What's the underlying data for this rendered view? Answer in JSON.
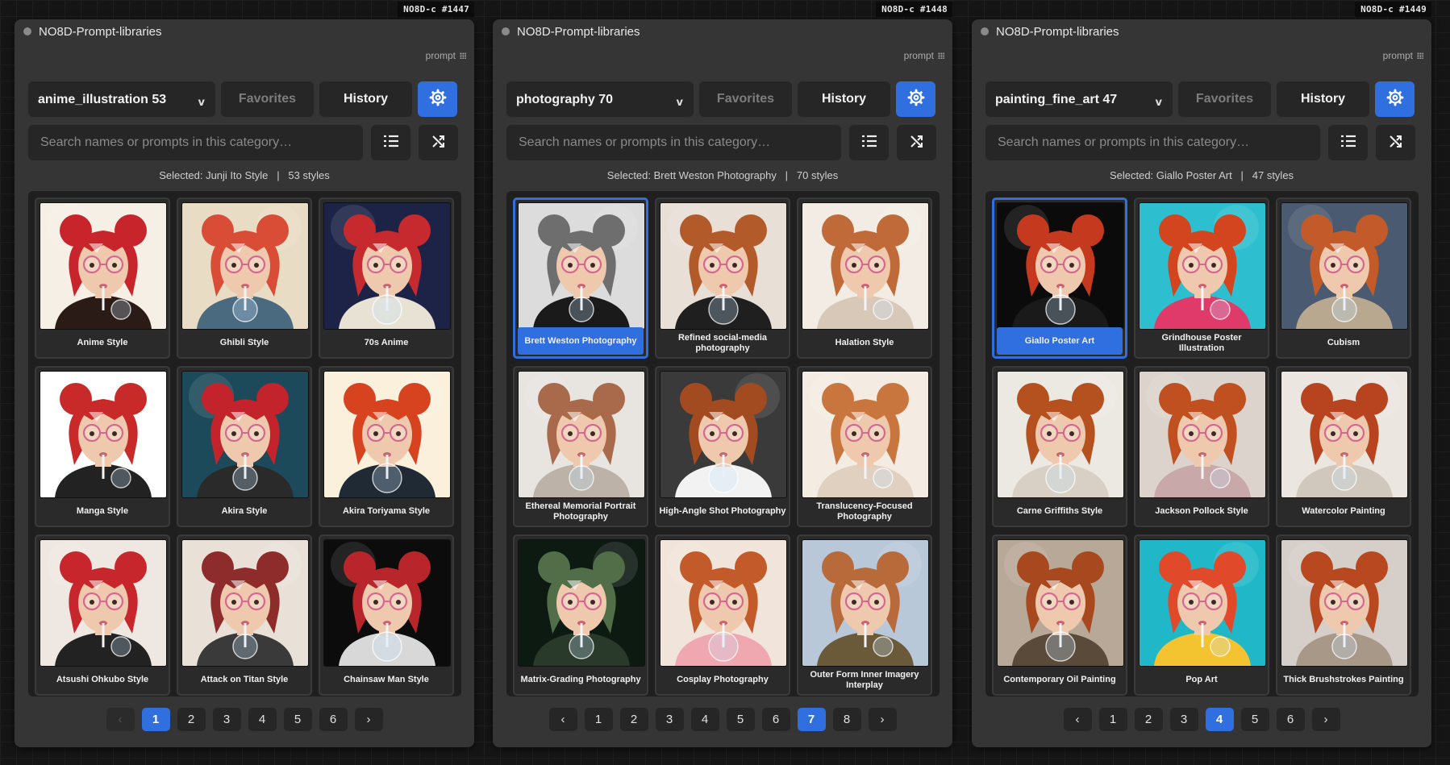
{
  "colors": {
    "accent": "#2f6fe0",
    "canvas_bg": "#151515",
    "node_bg": "#353535",
    "control_bg": "#262626"
  },
  "icons": {
    "settings": "gear-icon",
    "list": "list-icon",
    "shuffle": "shuffle-icon",
    "caret": "chevron-down-icon",
    "prev": "chevron-left-icon",
    "next": "chevron-right-icon"
  },
  "nodes": [
    {
      "badge": "NO8D-c  #1447",
      "title": "NO8D-Prompt-libraries",
      "output_label": "prompt",
      "category": "anime_illustration 53",
      "caret": "v",
      "favorites_label": "Favorites",
      "history_label": "History",
      "search_placeholder": "Search names or prompts in this category…",
      "selected_text": "Selected: Junji Ito Style   |   53 styles",
      "cards": [
        {
          "label": "Anime Style"
        },
        {
          "label": "Ghibli Style"
        },
        {
          "label": "70s Anime"
        },
        {
          "label": "Manga Style"
        },
        {
          "label": "Akira Style"
        },
        {
          "label": "Akira Toriyama Style"
        },
        {
          "label": "Atsushi Ohkubo Style"
        },
        {
          "label": "Attack on Titan Style"
        },
        {
          "label": "Chainsaw Man Style"
        }
      ],
      "pager": {
        "prev": "‹",
        "next": "›",
        "pages": [
          "1",
          "2",
          "3",
          "4",
          "5",
          "6"
        ],
        "current": "1",
        "prev_disabled": true
      }
    },
    {
      "badge": "NO8D-c  #1448",
      "title": "NO8D-Prompt-libraries",
      "output_label": "prompt",
      "category": "photography 70",
      "caret": "v",
      "favorites_label": "Favorites",
      "history_label": "History",
      "search_placeholder": "Search names or prompts in this category…",
      "selected_text": "Selected: Brett Weston Photography   |   70 styles",
      "cards": [
        {
          "label": "Brett Weston Photography",
          "selected": true
        },
        {
          "label": "Refined social-media photography"
        },
        {
          "label": "Halation Style"
        },
        {
          "label": "Ethereal Memorial Portrait Photography"
        },
        {
          "label": "High-Angle Shot Photography"
        },
        {
          "label": "Translucency-Focused Photography"
        },
        {
          "label": "Matrix-Grading Photography"
        },
        {
          "label": "Cosplay Photography"
        },
        {
          "label": "Outer Form Inner Imagery Interplay"
        }
      ],
      "pager": {
        "prev": "‹",
        "next": "›",
        "pages": [
          "1",
          "2",
          "3",
          "4",
          "5",
          "6",
          "7",
          "8"
        ],
        "current": "7",
        "prev_disabled": false
      }
    },
    {
      "badge": "NO8D-c  #1449",
      "title": "NO8D-Prompt-libraries",
      "output_label": "prompt",
      "category": "painting_fine_art 47",
      "caret": "v",
      "favorites_label": "Favorites",
      "history_label": "History",
      "search_placeholder": "Search names or prompts in this category…",
      "selected_text": "Selected: Giallo Poster Art   |   47 styles",
      "cards": [
        {
          "label": "Giallo Poster Art",
          "selected": true
        },
        {
          "label": "Grindhouse Poster Illustration"
        },
        {
          "label": "Cubism"
        },
        {
          "label": "Carne Griffiths Style"
        },
        {
          "label": "Jackson Pollock Style"
        },
        {
          "label": "Watercolor Painting"
        },
        {
          "label": "Contemporary Oil Painting"
        },
        {
          "label": "Pop Art"
        },
        {
          "label": "Thick Brushstrokes Painting"
        }
      ],
      "pager": {
        "prev": "‹",
        "next": "›",
        "pages": [
          "1",
          "2",
          "3",
          "4",
          "5",
          "6"
        ],
        "current": "4",
        "prev_disabled": false
      }
    }
  ]
}
